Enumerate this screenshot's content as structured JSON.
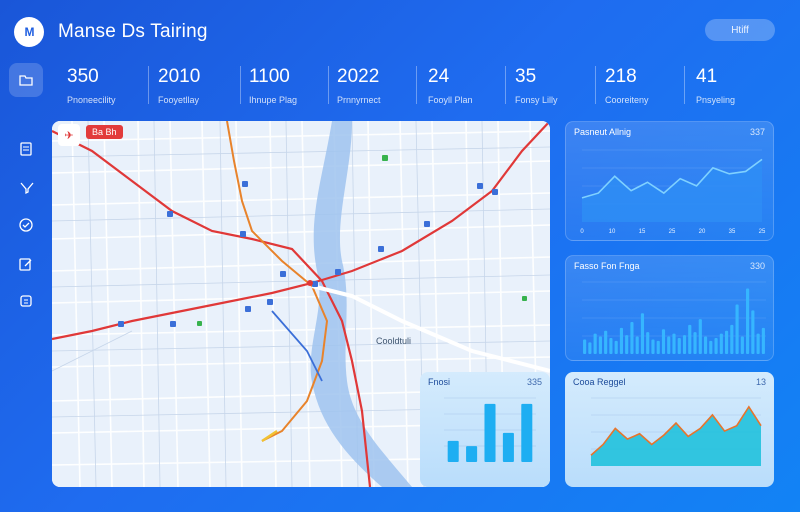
{
  "header": {
    "logo_text": "M",
    "title": "Manse Ds Tairing",
    "button_label": "Htiff"
  },
  "sidebar": {
    "items": [
      "folder-icon",
      "document-icon",
      "filter-icon",
      "check-icon",
      "edit-icon",
      "box-icon"
    ]
  },
  "stats": [
    {
      "value": "350",
      "label": "Pnoneecility"
    },
    {
      "value": "2010",
      "label": "Fooyetllay"
    },
    {
      "value": "1100",
      "label": "Ihnupe Plag"
    },
    {
      "value": "2022",
      "label": "Prnnyrnect"
    },
    {
      "value": "24",
      "label": "Fooyll Plan"
    },
    {
      "value": "35",
      "label": "Fonsy Lilly"
    },
    {
      "value": "218",
      "label": "Cooreiteny"
    },
    {
      "value": "41",
      "label": "Pnsyeling"
    }
  ],
  "map": {
    "badge": "Ba Bh",
    "area_label": "Cooldtuli",
    "compass": "✈"
  },
  "chart_data": [
    {
      "type": "area",
      "title": "Pasneut Allnig",
      "meta": "337",
      "yticks": [
        "",
        "",
        "",
        "",
        ""
      ],
      "xticks": [
        "0",
        "10",
        "15",
        "25",
        "20",
        "35",
        "25"
      ],
      "values": [
        20,
        24,
        38,
        26,
        33,
        24,
        36,
        30,
        45,
        40,
        42,
        52
      ]
    },
    {
      "type": "bar",
      "title": "Fasso Fon Fnga",
      "meta": "330",
      "values": [
        10,
        8,
        14,
        12,
        16,
        11,
        9,
        18,
        13,
        22,
        12,
        28,
        15,
        10,
        9,
        17,
        12,
        14,
        11,
        13,
        20,
        15,
        24,
        12,
        9,
        11,
        14,
        16,
        20,
        34,
        12,
        45,
        30,
        14,
        18
      ]
    },
    {
      "type": "bar",
      "title": "Fnosi",
      "meta": "335",
      "values": [
        8,
        6,
        22,
        11,
        22
      ]
    },
    {
      "type": "area",
      "title": "Cooa Reggel",
      "meta": "13",
      "values": [
        8,
        16,
        28,
        20,
        24,
        16,
        23,
        32,
        22,
        28,
        38,
        26,
        30,
        44,
        30
      ]
    }
  ]
}
